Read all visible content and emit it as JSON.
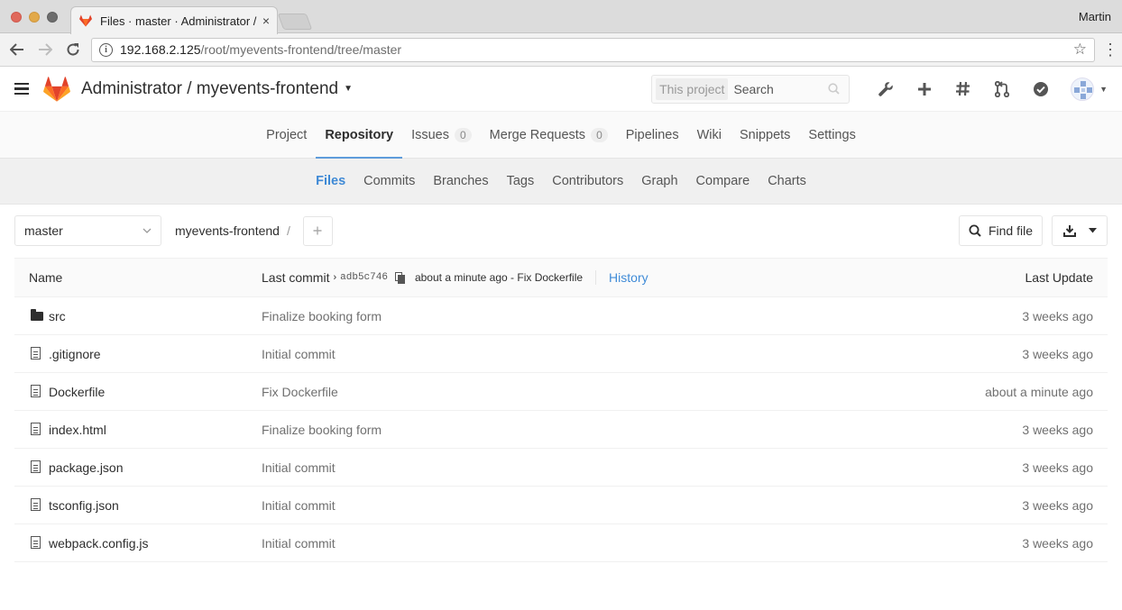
{
  "browser": {
    "tab_title": "Files · master · Administrator / myevents-frontend",
    "tab_close": "×",
    "profile_name": "Martin",
    "url_host": "192.168.2.125",
    "url_path": "/root/myevents-frontend/tree/master"
  },
  "header": {
    "project_path": "Administrator / myevents-frontend",
    "search_scope": "This project",
    "search_placeholder": "Search"
  },
  "project_nav": [
    {
      "label": "Project",
      "count": null,
      "active": false
    },
    {
      "label": "Repository",
      "count": null,
      "active": true
    },
    {
      "label": "Issues",
      "count": "0",
      "active": false
    },
    {
      "label": "Merge Requests",
      "count": "0",
      "active": false
    },
    {
      "label": "Pipelines",
      "count": null,
      "active": false
    },
    {
      "label": "Wiki",
      "count": null,
      "active": false
    },
    {
      "label": "Snippets",
      "count": null,
      "active": false
    },
    {
      "label": "Settings",
      "count": null,
      "active": false
    }
  ],
  "sub_nav": [
    {
      "label": "Files",
      "active": true
    },
    {
      "label": "Commits",
      "active": false
    },
    {
      "label": "Branches",
      "active": false
    },
    {
      "label": "Tags",
      "active": false
    },
    {
      "label": "Contributors",
      "active": false
    },
    {
      "label": "Graph",
      "active": false
    },
    {
      "label": "Compare",
      "active": false
    },
    {
      "label": "Charts",
      "active": false
    }
  ],
  "tree": {
    "branch": "master",
    "breadcrumb_project": "myevents-frontend",
    "breadcrumb_sep": "/",
    "find_file_label": "Find file"
  },
  "table": {
    "col_name": "Name",
    "col_last_commit": "Last commit",
    "commit_sha": "adb5c746",
    "commit_desc": "about a minute ago - Fix Dockerfile",
    "history_label": "History",
    "col_last_update": "Last Update",
    "rows": [
      {
        "type": "folder",
        "name": "src",
        "commit": "Finalize booking form",
        "updated": "3 weeks ago"
      },
      {
        "type": "file",
        "name": ".gitignore",
        "commit": "Initial commit",
        "updated": "3 weeks ago"
      },
      {
        "type": "file",
        "name": "Dockerfile",
        "commit": "Fix Dockerfile",
        "updated": "about a minute ago"
      },
      {
        "type": "file",
        "name": "index.html",
        "commit": "Finalize booking form",
        "updated": "3 weeks ago"
      },
      {
        "type": "file",
        "name": "package.json",
        "commit": "Initial commit",
        "updated": "3 weeks ago"
      },
      {
        "type": "file",
        "name": "tsconfig.json",
        "commit": "Initial commit",
        "updated": "3 weeks ago"
      },
      {
        "type": "file",
        "name": "webpack.config.js",
        "commit": "Initial commit",
        "updated": "3 weeks ago"
      }
    ]
  },
  "icons": {
    "logo": "gitlab-tanuki-icon",
    "header_actions": [
      "wrench-icon",
      "plus-icon",
      "hash-icon",
      "merge-request-icon",
      "todo-check-icon"
    ]
  },
  "colors": {
    "accent": "#1f78d1",
    "gitlab_orange": "#e2432a",
    "gitlab_orange_light": "#fc6d26",
    "gitlab_yellow": "#fca326"
  }
}
